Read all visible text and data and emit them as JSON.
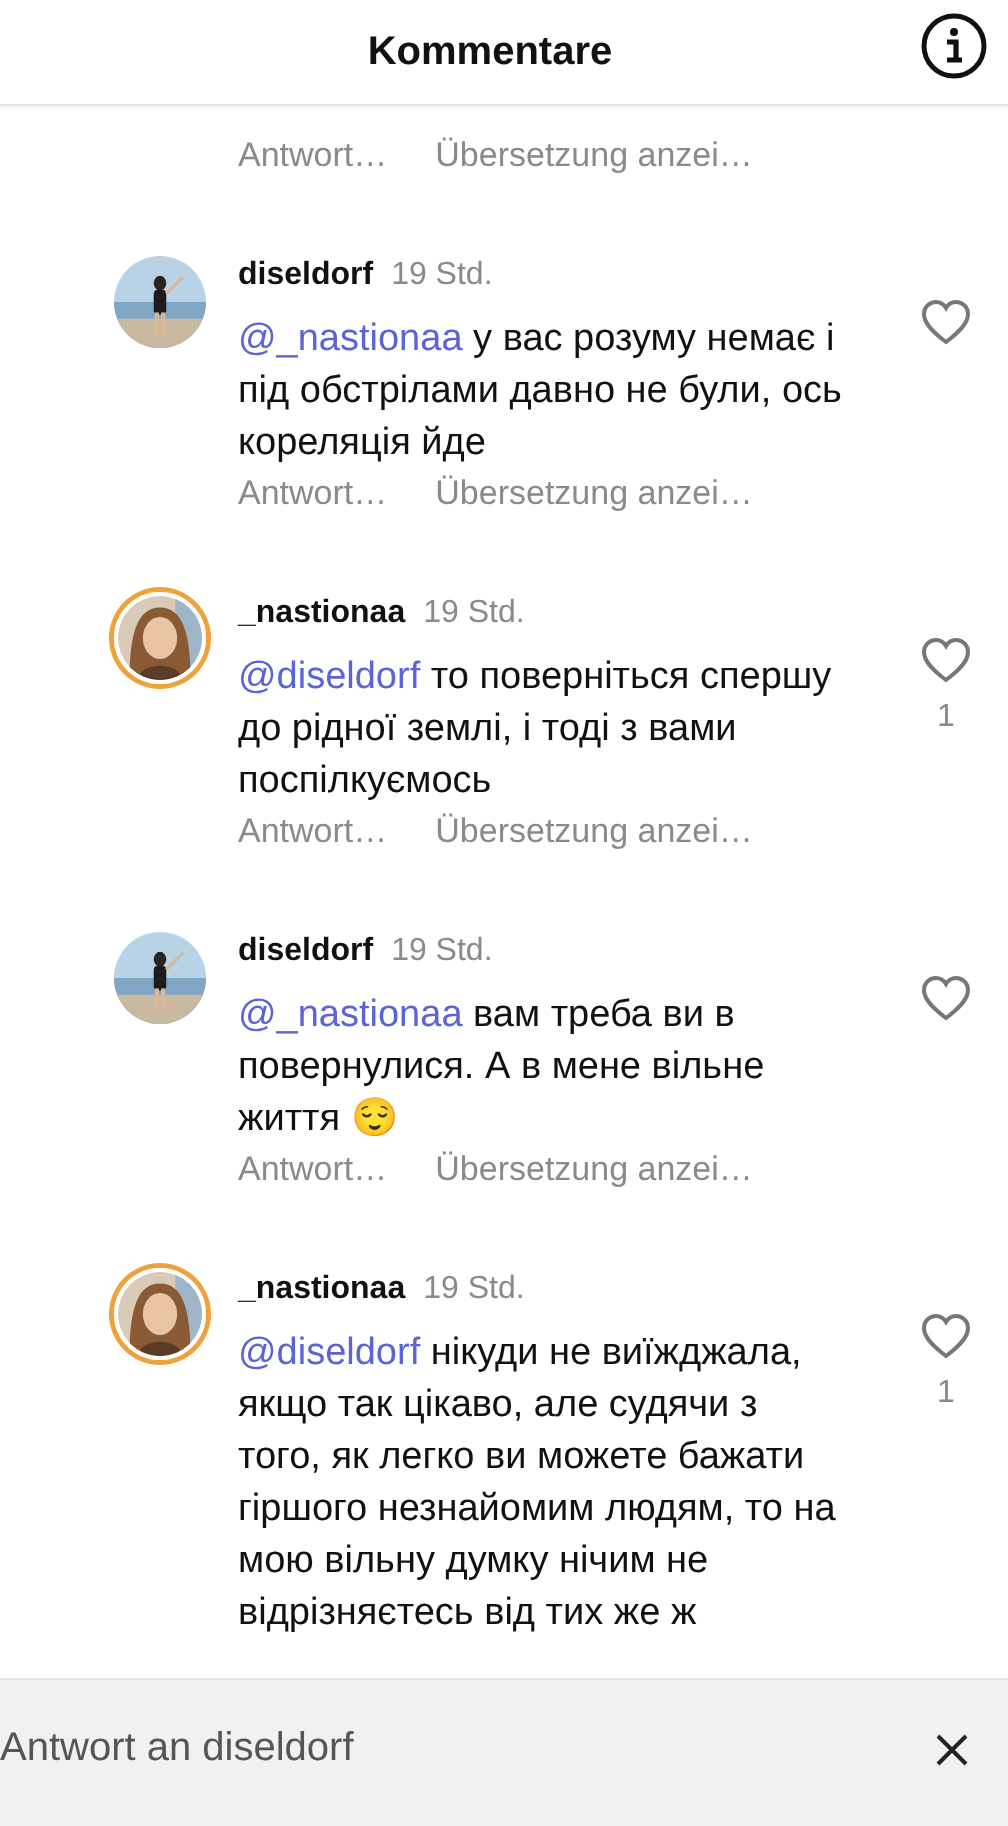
{
  "header": {
    "title": "Kommentare"
  },
  "top_actions": {
    "reply": "Antwort…",
    "translate": "Übersetzung anzei…"
  },
  "comments": [
    {
      "username": "diseldorf",
      "time": "19 Std.",
      "avatar": {
        "kind": "picture",
        "story_ring": false
      },
      "mention": "@_nastionaa",
      "text": "у вас розуму немає і під обстрілами давно не були, ось кореляція йде",
      "liked": false,
      "actions": {
        "reply": "Antwort…",
        "translate": "Übersetzung anzei…"
      }
    },
    {
      "username": "_nastionaa",
      "time": "19 Std.",
      "avatar": {
        "kind": "picture",
        "story_ring": true
      },
      "mention": "@diseldorf",
      "text": "то поверніться спершу до рідної землі, і тоді з вами поспілкуємось",
      "liked": false,
      "like_count": "1",
      "actions": {
        "reply": "Antwort…",
        "translate": "Übersetzung anzei…"
      }
    },
    {
      "username": "diseldorf",
      "time": "19 Std.",
      "avatar": {
        "kind": "picture",
        "story_ring": false
      },
      "mention": "@_nastionaa",
      "text": "вам треба ви в повернулися. А в мене вільне життя 😌",
      "liked": false,
      "actions": {
        "reply": "Antwort…",
        "translate": "Übersetzung anzei…"
      }
    },
    {
      "username": "_nastionaa",
      "time": "19 Std.",
      "avatar": {
        "kind": "picture",
        "story_ring": true
      },
      "mention": "@diseldorf",
      "text": "нікуди не виїжджала, якщо так цікаво, але судячи з того, як легко ви можете бажати гіршого незнайомим людям, то на мою вільну думку нічим не відрізняєтесь від тих же ж",
      "liked": false,
      "like_count": "1"
    }
  ],
  "reply_bar": {
    "text": "Antwort an diseldorf"
  }
}
